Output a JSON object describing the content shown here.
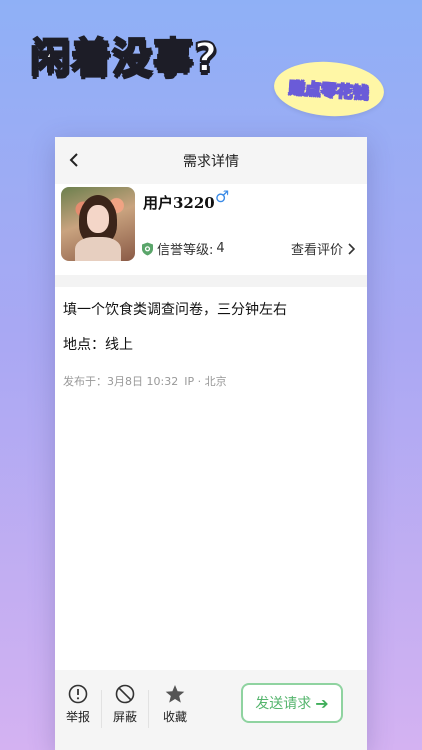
{
  "promo": {
    "headline": "闲着没事?",
    "bubble": "赚点零花钱"
  },
  "navbar": {
    "back_icon": "chevron-left-icon",
    "title": "需求详情"
  },
  "user": {
    "name": "用户3220",
    "gender_symbol": "♂",
    "credit_label": "信誉等级:",
    "credit_level": "4",
    "reviews_link": "查看评价",
    "reviews_icon": "chevron-right-icon"
  },
  "post": {
    "description": "填一个饮食类调查问卷，三分钟左右",
    "location": "地点：线上",
    "published": "发布于：3月8日 10:32",
    "ip": "IP · 北京"
  },
  "actions": [
    {
      "icon": "exclamation-circle-icon",
      "label": "举报"
    },
    {
      "icon": "block-icon",
      "label": "屏蔽"
    },
    {
      "icon": "star-icon",
      "label": "收藏"
    }
  ],
  "send_button": {
    "label": "发送请求",
    "arrow": "➔",
    "color": "#55b56d"
  },
  "colors": {
    "accent_green": "#55b56d",
    "gender_blue": "#3b8be6"
  }
}
